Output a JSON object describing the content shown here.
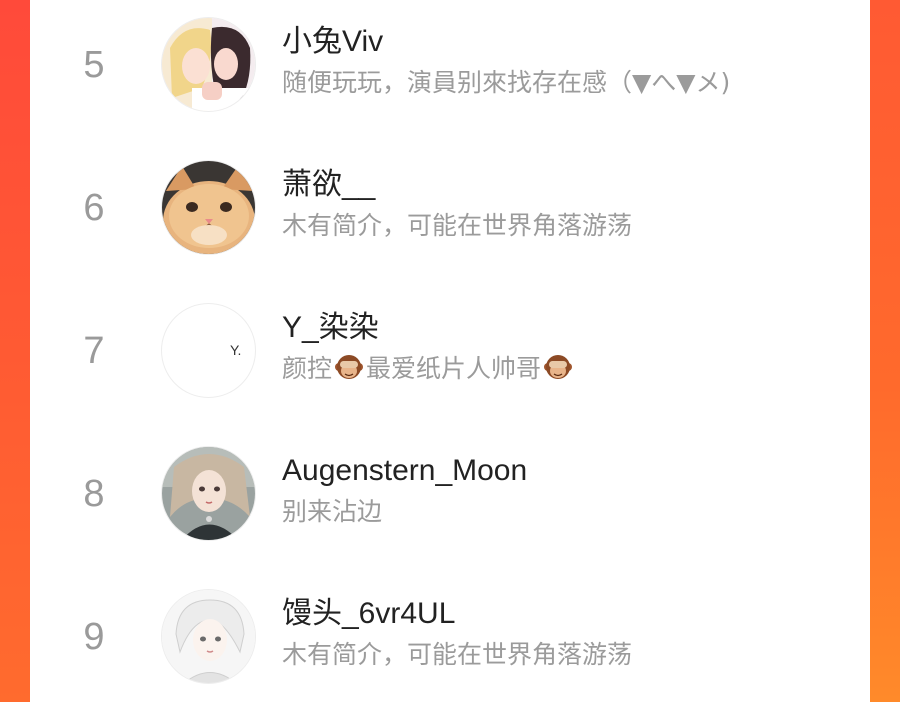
{
  "colors": {
    "accent_left": "#ff4a3a",
    "accent_right": "#ff7a2b",
    "rank_text": "#9a9a9a",
    "name_text": "#222222",
    "bio_text": "#9b9b9b"
  },
  "users": [
    {
      "rank": "5",
      "name": "小兔Viv",
      "bio": "随便玩玩，演員别來找存在感（▼へ▼メ)",
      "avatar_icon": "anime-couple-avatar-icon"
    },
    {
      "rank": "6",
      "name": "萧欲__",
      "bio": "木有简介，可能在世界角落游荡",
      "avatar_icon": "cat-avatar-icon"
    },
    {
      "rank": "7",
      "name": "Y_染染",
      "bio_parts": [
        "颜控",
        "最爱纸片人帅哥"
      ],
      "avatar_text": "Y.",
      "avatar_icon": "text-avatar-icon",
      "bio_emoji_icon": "see-no-evil-monkey-icon"
    },
    {
      "rank": "8",
      "name": "Augenstern_Moon",
      "bio": "别来沾边",
      "avatar_icon": "illustrated-girl-avatar-icon"
    },
    {
      "rank": "9",
      "name": "馒头_6vr4UL",
      "bio": "木有简介，可能在世界角落游荡",
      "avatar_icon": "white-hair-boy-avatar-icon"
    }
  ]
}
